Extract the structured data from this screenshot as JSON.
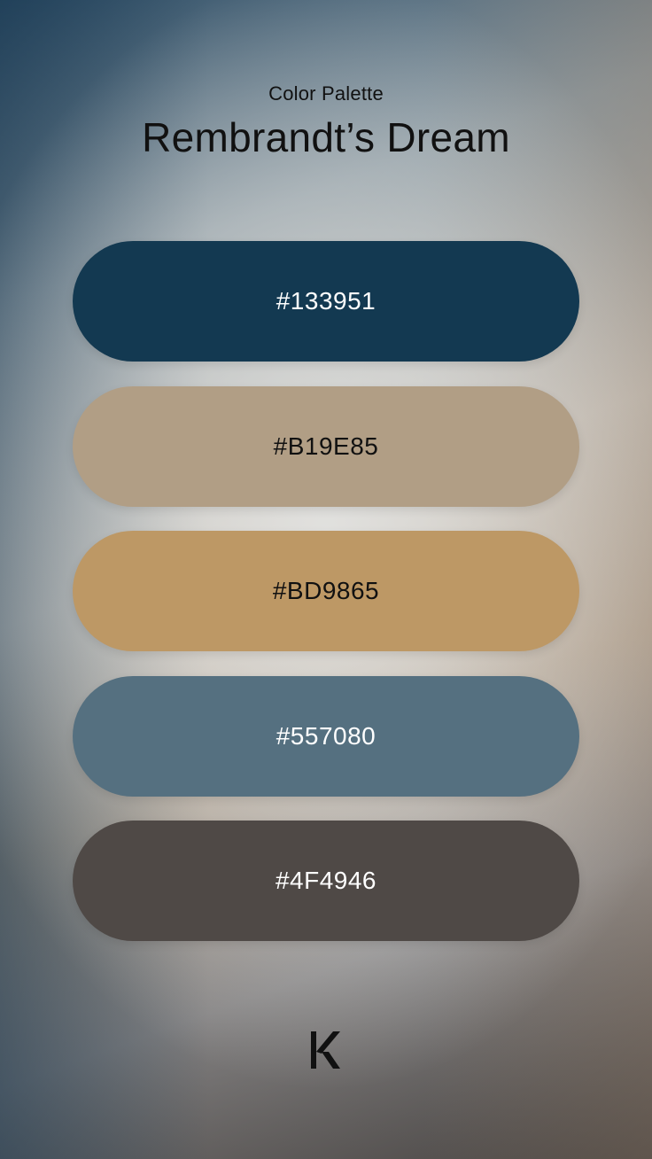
{
  "header": {
    "subtitle": "Color Palette",
    "title": "Rembrandt’s Dream"
  },
  "swatches": [
    {
      "hex": "#133951",
      "label": "#133951",
      "text_color": "#ffffff"
    },
    {
      "hex": "#B19E85",
      "label": "#B19E85",
      "text_color": "#111111"
    },
    {
      "hex": "#BD9865",
      "label": "#BD9865",
      "text_color": "#111111"
    },
    {
      "hex": "#557080",
      "label": "#557080",
      "text_color": "#ffffff"
    },
    {
      "hex": "#4F4946",
      "label": "#4F4946",
      "text_color": "#ffffff"
    }
  ],
  "logo": {
    "icon": "k-logo-icon",
    "color": "#111111"
  }
}
